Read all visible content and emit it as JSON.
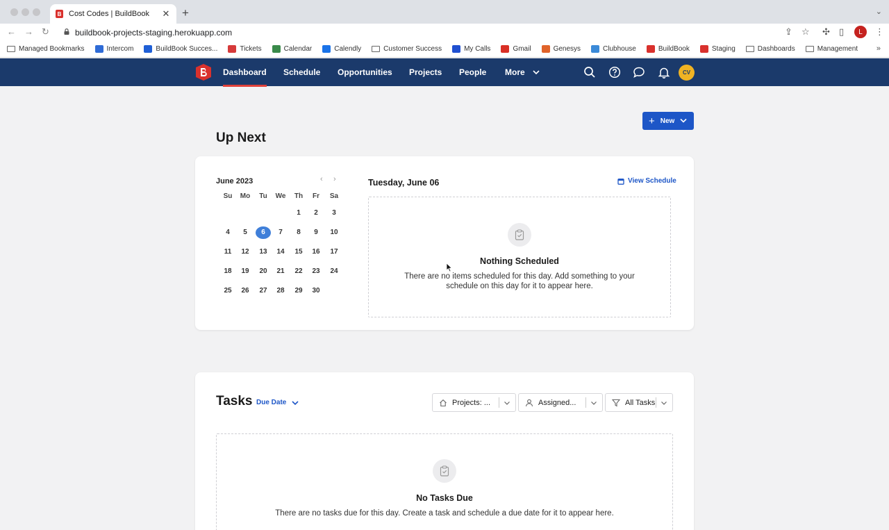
{
  "browser": {
    "tab_title": "Cost Codes | BuildBook",
    "tab_favicon_letter": "B",
    "url": "buildbook-projects-staging.herokuapp.com",
    "profile_letter": "L",
    "bookmarks": [
      {
        "label": "Managed Bookmarks",
        "icon": "folder-icon",
        "color": ""
      },
      {
        "label": "Intercom",
        "icon": "intercom-icon",
        "color": "#2f6bd6"
      },
      {
        "label": "BuildBook Succes...",
        "icon": "confluence-icon",
        "color": "#1f5fd6"
      },
      {
        "label": "Tickets",
        "icon": "tickets-icon",
        "color": "#d63a3a"
      },
      {
        "label": "Calendar",
        "icon": "calendar-icon",
        "color": "#3a8a4a"
      },
      {
        "label": "Calendly",
        "icon": "calendly-icon",
        "color": "#1a73e8"
      },
      {
        "label": "Customer Success",
        "icon": "folder-icon",
        "color": ""
      },
      {
        "label": "My Calls",
        "icon": "calls-icon",
        "color": "#2050d0"
      },
      {
        "label": "Gmail",
        "icon": "gmail-icon",
        "color": "#d93025"
      },
      {
        "label": "Genesys",
        "icon": "genesys-icon",
        "color": "#e0632a"
      },
      {
        "label": "Clubhouse",
        "icon": "clubhouse-icon",
        "color": "#3b8ad8"
      },
      {
        "label": "BuildBook",
        "icon": "buildbook-icon",
        "color": "#d9312d"
      },
      {
        "label": "Staging",
        "icon": "buildbook-icon",
        "color": "#d9312d"
      },
      {
        "label": "Dashboards",
        "icon": "folder-icon",
        "color": ""
      },
      {
        "label": "Management",
        "icon": "folder-icon",
        "color": ""
      }
    ],
    "overflow": "»"
  },
  "nav": {
    "items": [
      "Dashboard",
      "Schedule",
      "Opportunities",
      "Projects",
      "People",
      "More"
    ],
    "active": "Dashboard",
    "avatar_initials": "CV"
  },
  "toolbar": {
    "new_label": "New"
  },
  "up_next": {
    "heading": "Up Next",
    "calendar": {
      "month_label": "June 2023",
      "weekdays": [
        "Su",
        "Mo",
        "Tu",
        "We",
        "Th",
        "Fr",
        "Sa"
      ],
      "first_weekday_index": 4,
      "days_in_month": 30,
      "selected_day": 6
    },
    "date_heading": "Tuesday, June 06",
    "view_schedule_label": "View Schedule",
    "empty_title": "Nothing Scheduled",
    "empty_text_line1": "There are no items scheduled for this day. Add something to your",
    "empty_text_line2": "schedule on this day for it to appear here."
  },
  "tasks": {
    "heading": "Tasks",
    "sort_label": "Due Date",
    "filters": [
      {
        "label": "Projects: ...",
        "icon": "home-icon"
      },
      {
        "label": "Assigned...",
        "icon": "user-icon"
      },
      {
        "label": "All Tasks",
        "icon": "filter-icon"
      }
    ],
    "empty_title": "No Tasks Due",
    "empty_text": "There are no tasks due for this day. Create a task and schedule a due date for it to appear here."
  },
  "colors": {
    "nav_bg": "#1b3a6b",
    "accent_blue": "#1d56c7",
    "selected_day": "#3f7fd9",
    "brand_red": "#d9312d",
    "avatar": "#f0b323"
  }
}
